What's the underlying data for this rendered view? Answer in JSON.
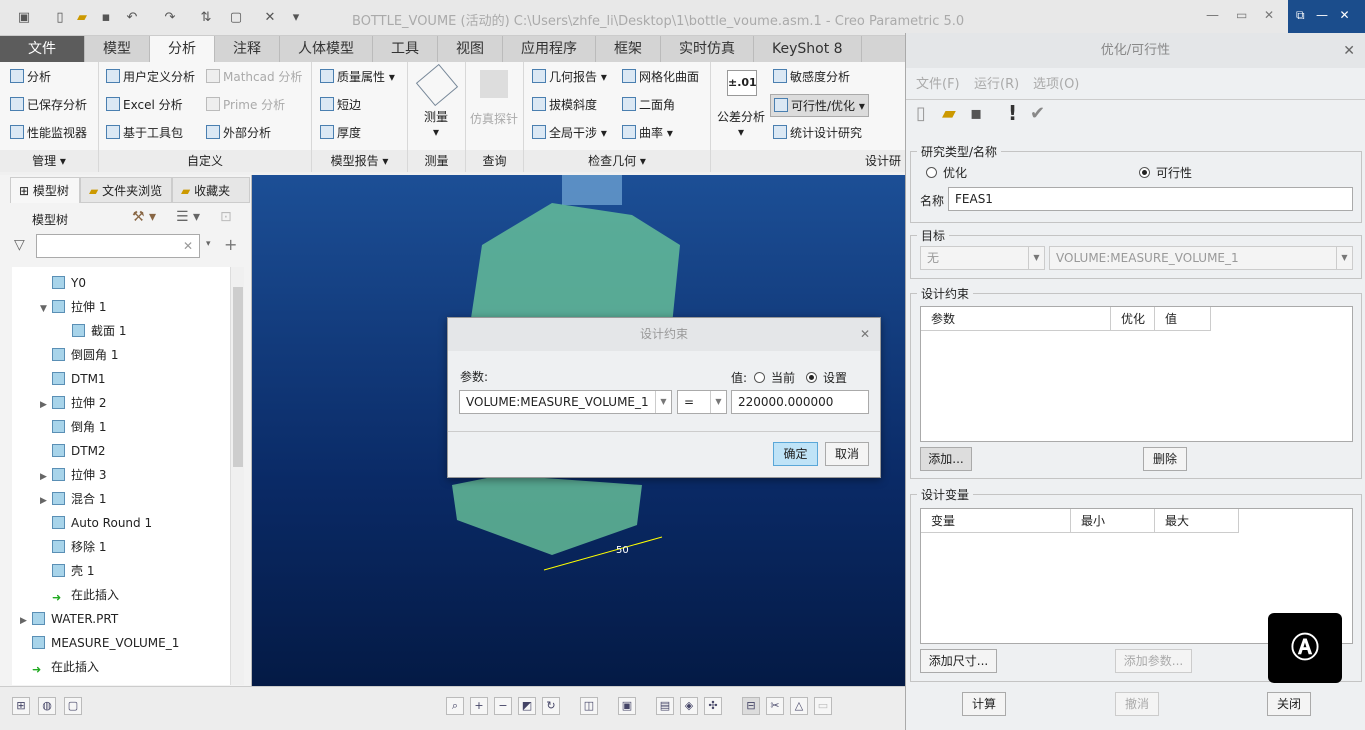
{
  "window": {
    "title": "BOTTLE_VOUME (活动的) C:\\Users\\zhfe_li\\Desktop\\1\\bottle_voume.asm.1 - Creo Parametric 5.0"
  },
  "tabs": [
    "文件",
    "模型",
    "分析",
    "注释",
    "人体模型",
    "工具",
    "视图",
    "应用程序",
    "框架",
    "实时仿真",
    "KeyShot 8"
  ],
  "ribbon": {
    "manage": {
      "items": [
        "分析",
        "已保存分析",
        "性能监视器"
      ],
      "label": "管理"
    },
    "custom": {
      "items": [
        "用户定义分析",
        "Excel 分析",
        "基于工具包",
        "Mathcad 分析",
        "Prime 分析",
        "外部分析"
      ],
      "label": "自定义"
    },
    "report": {
      "items": [
        "质量属性",
        "短边",
        "厚度"
      ],
      "label": "模型报告"
    },
    "measure": {
      "item": "测量",
      "label": "测量"
    },
    "query": {
      "item": "仿真探针",
      "label": "查询"
    },
    "inspect": {
      "items": [
        "几何报告",
        "拔模斜度",
        "全局干涉",
        "网格化曲面",
        "二面角",
        "曲率"
      ],
      "label": "检查几何"
    },
    "design": {
      "items": [
        "公差分析",
        "敏感度分析",
        "可行性/优化",
        "统计设计研究"
      ],
      "tol_icon": "±.01",
      "label": "设计研"
    }
  },
  "left": {
    "tabs": [
      "模型树",
      "文件夹浏览",
      "收藏夹"
    ],
    "header": "模型树",
    "search_placeholder": "",
    "tree": [
      "Y0",
      "拉伸 1",
      "截面 1",
      "倒圆角 1",
      "DTM1",
      "拉伸 2",
      "倒角 1",
      "DTM2",
      "拉伸 3",
      "混合 1",
      "Auto Round 1",
      "移除 1",
      "壳 1",
      "在此插入",
      "WATER.PRT",
      "MEASURE_VOLUME_1",
      "在此插入"
    ]
  },
  "viewport": {
    "dimension": "50"
  },
  "dialog": {
    "title": "优化/可行性",
    "menu": [
      "文件(F)",
      "运行(R)",
      "选项(O)"
    ],
    "study": {
      "legend": "研究类型/名称",
      "opt": "优化",
      "feas": "可行性",
      "name_label": "名称",
      "name": "FEAS1"
    },
    "goal": {
      "legend": "目标",
      "sel1": "无",
      "sel2": "VOLUME:MEASURE_VOLUME_1"
    },
    "constraints": {
      "legend": "设计约束",
      "cols": [
        "参数",
        "优化",
        "值"
      ],
      "add": "添加...",
      "del": "删除"
    },
    "variables": {
      "legend": "设计变量",
      "cols": [
        "变量",
        "最小",
        "最大"
      ],
      "add_dim": "添加尺寸...",
      "add_param": "添加参数..."
    },
    "buttons": {
      "compute": "计算",
      "undo": "撤消",
      "close": "关闭"
    }
  },
  "constraint_dialog": {
    "title": "设计约束",
    "param_label": "参数:",
    "value_label": "值:",
    "current": "当前",
    "set": "设置",
    "param": "VOLUME:MEASURE_VOLUME_1",
    "op": "=",
    "value": "220000.000000",
    "ok": "确定",
    "cancel": "取消"
  },
  "colors": {
    "accent": "#0a2a66",
    "ok_button": "#bfe3f7"
  }
}
